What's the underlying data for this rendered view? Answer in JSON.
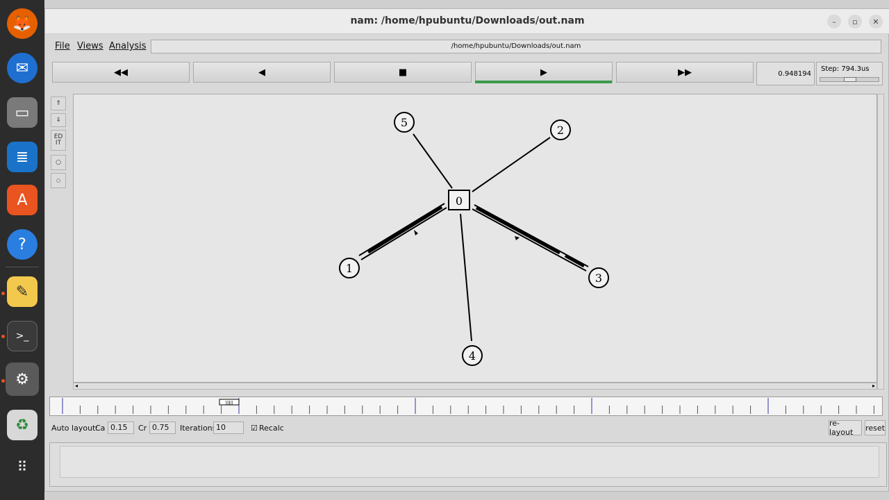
{
  "window": {
    "title": "nam: /home/hpubuntu/Downloads/out.nam"
  },
  "menu": {
    "file": "File",
    "views": "Views",
    "analysis": "Analysis"
  },
  "filepath": "/home/hpubuntu/Downloads/out.nam",
  "controls": {
    "rewind": "◀◀",
    "back": "◀",
    "stop": "■",
    "play": "▶",
    "fast_forward": "▶▶"
  },
  "time_value": "0.948194",
  "step_label": "Step: 794.3us",
  "tools": {
    "edit": "ED IT"
  },
  "network": {
    "nodes": [
      {
        "id": "0",
        "shape": "square"
      },
      {
        "id": "1",
        "shape": "circle"
      },
      {
        "id": "2",
        "shape": "circle"
      },
      {
        "id": "3",
        "shape": "circle"
      },
      {
        "id": "4",
        "shape": "circle"
      },
      {
        "id": "5",
        "shape": "circle"
      }
    ],
    "links": [
      {
        "from": "0",
        "to": "5",
        "type": "simplex"
      },
      {
        "from": "0",
        "to": "2",
        "type": "simplex"
      },
      {
        "from": "0",
        "to": "4",
        "type": "simplex"
      },
      {
        "from": "0",
        "to": "1",
        "type": "duplex-busy"
      },
      {
        "from": "0",
        "to": "3",
        "type": "duplex-busy"
      }
    ]
  },
  "autolayout": {
    "label": "Auto layout:",
    "ca_label": "Ca",
    "ca_value": "0.15",
    "cr_label": "Cr",
    "cr_value": "0.75",
    "iterations_label": "Iterations",
    "iterations_value": "10",
    "recalc_label": "Recalc",
    "recalc_checked": true,
    "relayout_button": "re-layout",
    "reset_button": "reset"
  },
  "colors": {
    "accent_play": "#3a9a4a",
    "dock": "#2c2c2c",
    "dock_active_dot": "#e95420"
  }
}
